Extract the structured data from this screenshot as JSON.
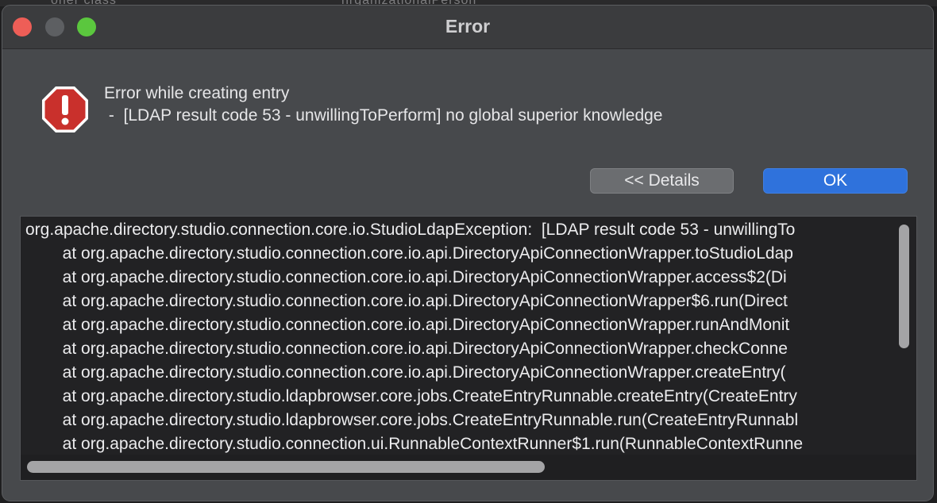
{
  "background_ghost_text": [
    "oner class",
    "nrganizationalPerson"
  ],
  "window": {
    "title": "Error"
  },
  "icon": {
    "name": "stop-sign-exclamation-icon",
    "color": "#c9302c"
  },
  "message": {
    "title": "Error while creating entry",
    "detail": " -  [LDAP result code 53 - unwillingToPerform] no global superior knowledge"
  },
  "buttons": {
    "details_label": "<< Details",
    "ok_label": "OK"
  },
  "trace_lines": [
    "org.apache.directory.studio.connection.core.io.StudioLdapException:  [LDAP result code 53 - unwillingTo",
    "        at org.apache.directory.studio.connection.core.io.api.DirectoryApiConnectionWrapper.toStudioLdap",
    "        at org.apache.directory.studio.connection.core.io.api.DirectoryApiConnectionWrapper.access$2(Di",
    "        at org.apache.directory.studio.connection.core.io.api.DirectoryApiConnectionWrapper$6.run(Direct",
    "        at org.apache.directory.studio.connection.core.io.api.DirectoryApiConnectionWrapper.runAndMonit",
    "        at org.apache.directory.studio.connection.core.io.api.DirectoryApiConnectionWrapper.checkConne",
    "        at org.apache.directory.studio.connection.core.io.api.DirectoryApiConnectionWrapper.createEntry(",
    "        at org.apache.directory.studio.ldapbrowser.core.jobs.CreateEntryRunnable.createEntry(CreateEntry",
    "        at org.apache.directory.studio.ldapbrowser.core.jobs.CreateEntryRunnable.run(CreateEntryRunnabl",
    "        at org.apache.directory.studio.connection.ui.RunnableContextRunner$1.run(RunnableContextRunne"
  ],
  "colors": {
    "close": "#ee5e57",
    "minimize": "#5d5f62",
    "zoom": "#5bc73e",
    "ok_accent": "#2f72dc"
  }
}
